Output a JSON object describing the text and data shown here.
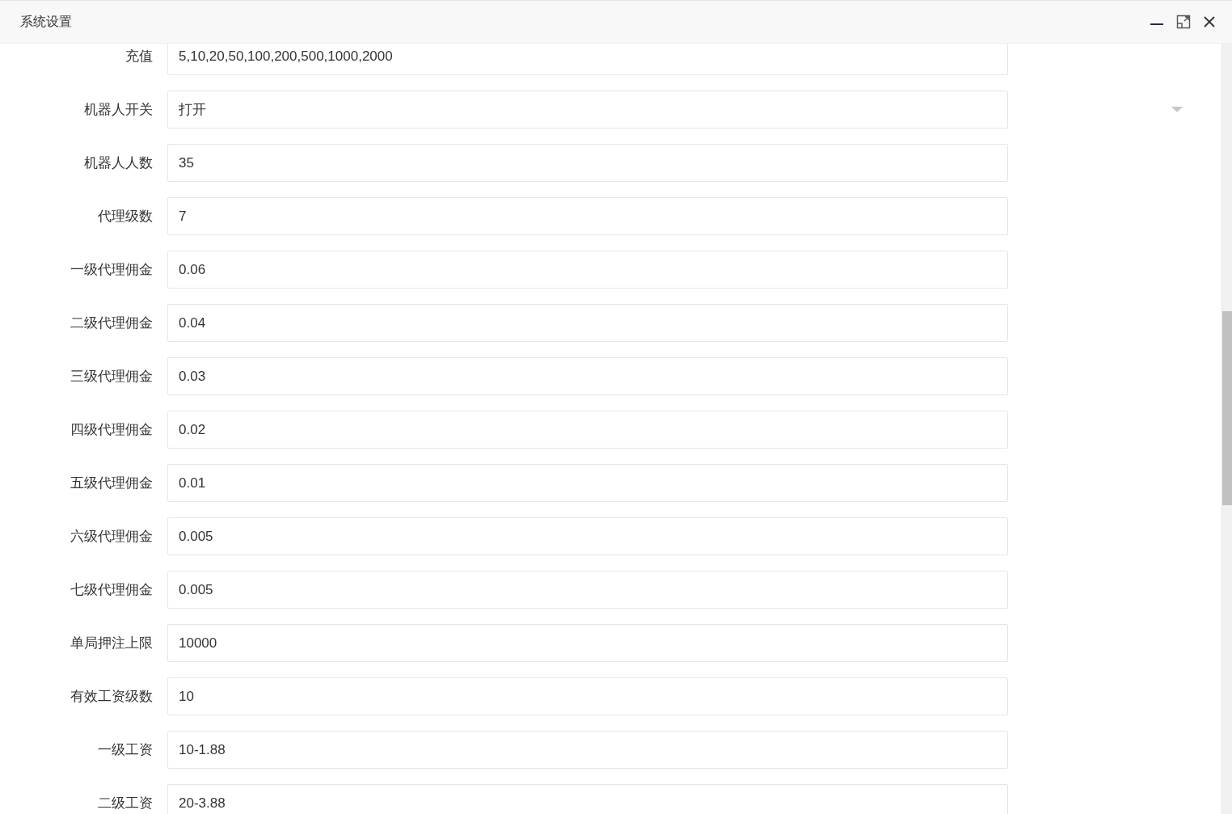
{
  "window": {
    "title": "系统设置"
  },
  "fields": [
    {
      "label": "充值",
      "kind": "input",
      "value": "5,10,20,50,100,200,500,1000,2000"
    },
    {
      "label": "机器人开关",
      "kind": "select",
      "value": "打开"
    },
    {
      "label": "机器人人数",
      "kind": "input",
      "value": "35"
    },
    {
      "label": "代理级数",
      "kind": "input",
      "value": "7"
    },
    {
      "label": "一级代理佣金",
      "kind": "input",
      "value": "0.06"
    },
    {
      "label": "二级代理佣金",
      "kind": "input",
      "value": "0.04"
    },
    {
      "label": "三级代理佣金",
      "kind": "input",
      "value": "0.03"
    },
    {
      "label": "四级代理佣金",
      "kind": "input",
      "value": "0.02"
    },
    {
      "label": "五级代理佣金",
      "kind": "input",
      "value": "0.01"
    },
    {
      "label": "六级代理佣金",
      "kind": "input",
      "value": "0.005"
    },
    {
      "label": "七级代理佣金",
      "kind": "input",
      "value": "0.005"
    },
    {
      "label": "单局押注上限",
      "kind": "input",
      "value": "10000"
    },
    {
      "label": "有效工资级数",
      "kind": "input",
      "value": "10"
    },
    {
      "label": "一级工资",
      "kind": "input",
      "value": "10-1.88"
    },
    {
      "label": "二级工资",
      "kind": "input",
      "value": "20-3.88"
    }
  ]
}
